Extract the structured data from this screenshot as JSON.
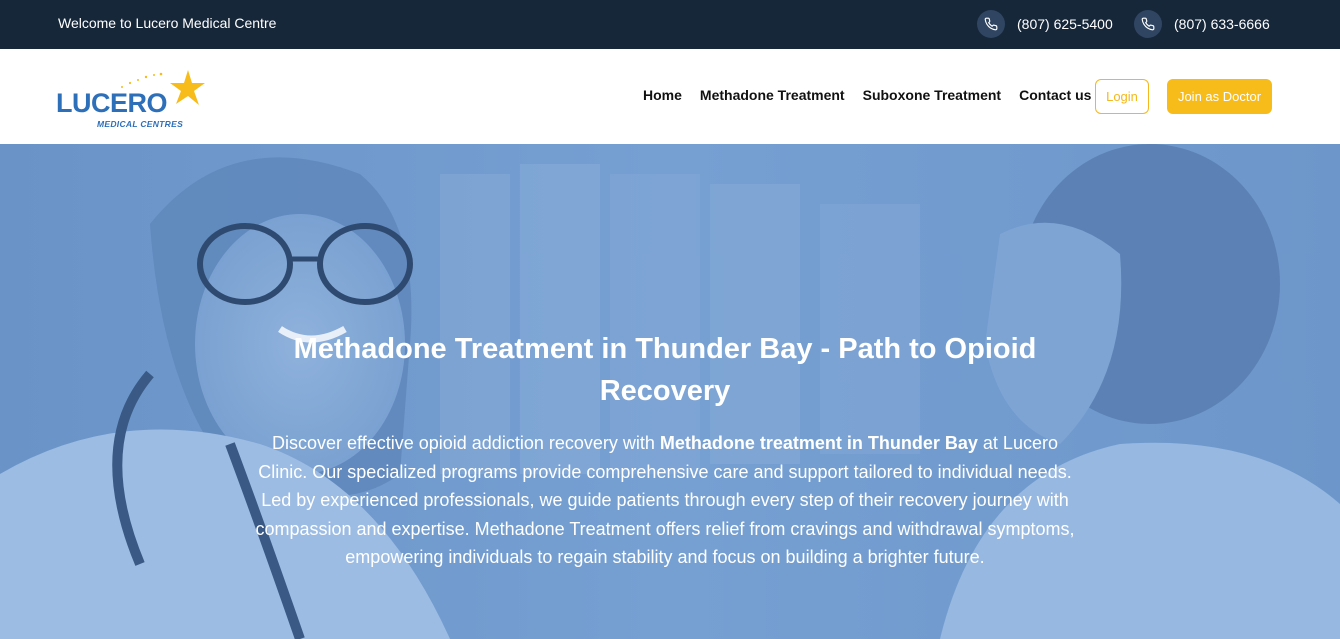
{
  "topbar": {
    "welcome": "Welcome to Lucero Medical Centre",
    "phones": [
      "(807) 625-5400",
      "(807) 633-6666"
    ],
    "background": "#17273a"
  },
  "header": {
    "logo": {
      "word": "LUCERO",
      "subtitle": "MEDICAL CENTRES",
      "color": "#2d6fb8",
      "star_color": "#f7bb1a"
    },
    "nav": [
      "Home",
      "Methadone Treatment",
      "Suboxone Treatment",
      "Contact us"
    ],
    "login_label": "Login",
    "join_label": "Join as Doctor",
    "accent": "#f7bb1a"
  },
  "hero": {
    "title": "Methadone Treatment in Thunder Bay - Path to Opioid Recovery",
    "desc_before": "Discover effective opioid addiction recovery with ",
    "desc_bold": "Methadone treatment in Thunder Bay",
    "desc_after": " at Lucero Clinic. Our specialized programs provide comprehensive care and support tailored to individual needs. Led by experienced professionals, we guide patients through every step of their recovery journey with compassion and expertise. Methadone Treatment offers relief from cravings and withdrawal symptoms, empowering individuals to regain stability and focus on building a brighter future.",
    "overlay_color": "#6f98cb"
  },
  "icons": {
    "phone": "phone-icon",
    "star": "star-icon"
  }
}
